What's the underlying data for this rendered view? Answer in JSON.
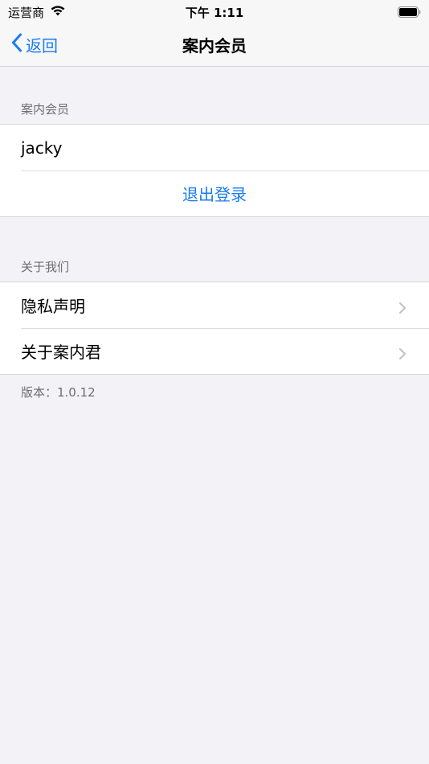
{
  "status_bar": {
    "carrier": "运营商",
    "time": "下午 1:11"
  },
  "nav": {
    "back_label": "返回",
    "title": "案内会员"
  },
  "member_section": {
    "header": "案内会员",
    "username": "jacky",
    "logout_label": "退出登录"
  },
  "about_section": {
    "header": "关于我们",
    "items": [
      {
        "label": "隐私声明"
      },
      {
        "label": "关于案内君"
      }
    ]
  },
  "version": {
    "text": "版本：1.0.12"
  },
  "colors": {
    "accent": "#1a7cf0",
    "background": "#f2f2f7",
    "section_text": "#6d6d72"
  }
}
